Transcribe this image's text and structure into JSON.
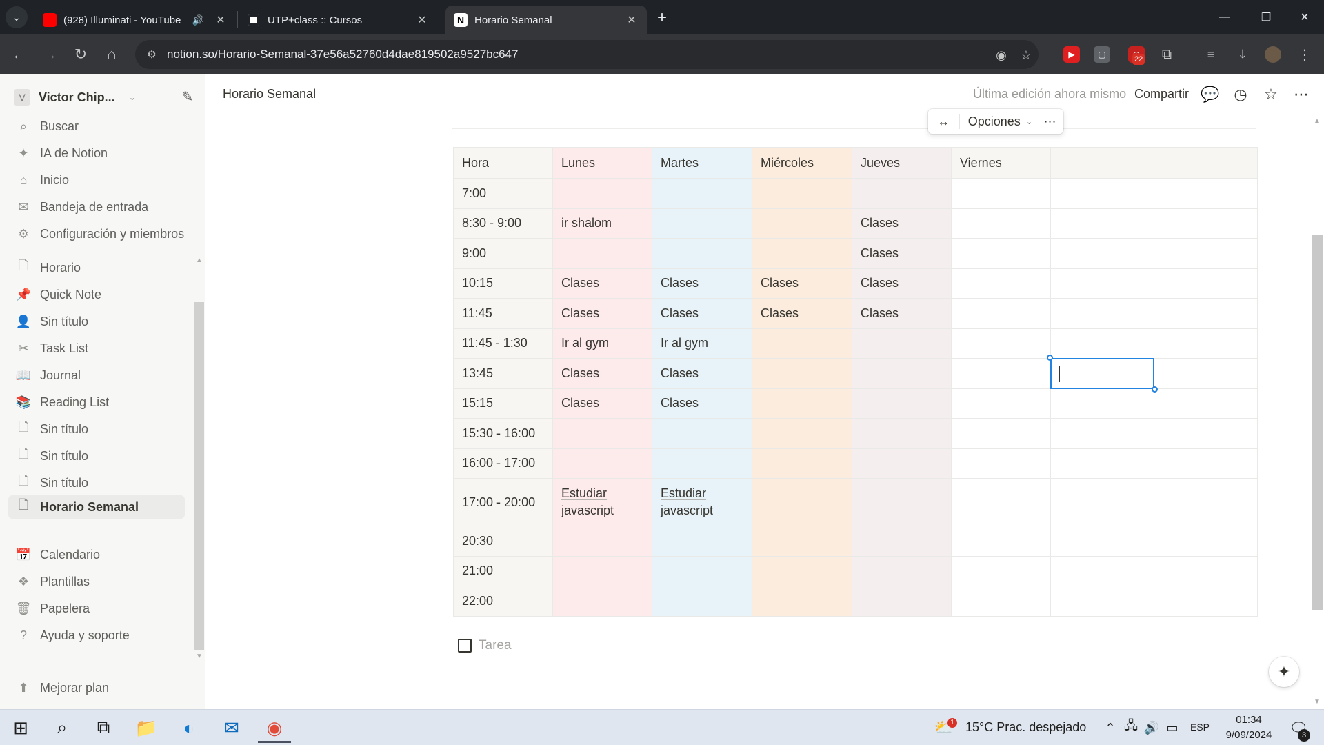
{
  "browser": {
    "tabs": [
      {
        "title": "(928) Illuminati - YouTube",
        "favicon": "youtube-icon",
        "color": "#ff0000"
      },
      {
        "title": "UTP+class :: Cursos",
        "favicon": "utp-icon",
        "color": "#ffffff"
      },
      {
        "title": "Horario Semanal",
        "favicon": "notion-icon",
        "color": "#ffffff"
      }
    ],
    "url": "notion.so/Horario-Semanal-37e56a52760d4dae819502a9527bc647",
    "extension_badge": "22"
  },
  "sidebar": {
    "workspace_initial": "V",
    "workspace_name": "Victor Chip...",
    "top_items": [
      {
        "label": "Buscar",
        "icon": "search-icon"
      },
      {
        "label": "IA de Notion",
        "icon": "sparkle-icon"
      },
      {
        "label": "Inicio",
        "icon": "home-icon"
      },
      {
        "label": "Bandeja de entrada",
        "icon": "inbox-icon"
      },
      {
        "label": "Configuración y miembros",
        "icon": "gear-icon"
      }
    ],
    "pages": [
      {
        "label": "Horario",
        "icon": "page-icon"
      },
      {
        "label": "Quick Note",
        "icon": "pin-icon"
      },
      {
        "label": "Sin título",
        "icon": "person-icon"
      },
      {
        "label": "Task List",
        "icon": "scissors-icon"
      },
      {
        "label": "Journal",
        "icon": "book-icon"
      },
      {
        "label": "Reading List",
        "icon": "books-icon"
      },
      {
        "label": "Sin título",
        "icon": "page-icon"
      },
      {
        "label": "Sin título",
        "icon": "page-icon"
      },
      {
        "label": "Sin título",
        "icon": "page-icon"
      },
      {
        "label": "Horario Semanal",
        "icon": "page-icon"
      }
    ],
    "bottom_items": [
      {
        "label": "Calendario",
        "icon": "calendar-icon"
      },
      {
        "label": "Plantillas",
        "icon": "templates-icon"
      },
      {
        "label": "Papelera",
        "icon": "trash-icon"
      },
      {
        "label": "Ayuda y soporte",
        "icon": "help-icon"
      }
    ],
    "upgrade_label": "Mejorar plan"
  },
  "topbar": {
    "breadcrumb": "Horario Semanal",
    "last_edited": "Última edición ahora mismo",
    "share_label": "Compartir"
  },
  "table_toolbar": {
    "options_label": "Opciones"
  },
  "schedule": {
    "headers": [
      "Hora",
      "Lunes",
      "Martes",
      "Miércoles",
      "Jueves",
      "Viernes",
      "",
      ""
    ],
    "rows": [
      [
        "7:00",
        "",
        "",
        "",
        "",
        "",
        "",
        ""
      ],
      [
        "8:30 - 9:00",
        "ir shalom",
        "",
        "",
        "Clases",
        "",
        "",
        ""
      ],
      [
        "9:00",
        "",
        "",
        "",
        "Clases",
        "",
        "",
        ""
      ],
      [
        "10:15",
        "Clases",
        "Clases",
        "Clases",
        "Clases",
        "",
        "",
        ""
      ],
      [
        "11:45",
        "Clases",
        "Clases",
        "Clases",
        "Clases",
        "",
        "",
        ""
      ],
      [
        "11:45 - 1:30",
        "Ir al gym",
        "Ir al gym",
        "",
        "",
        "",
        "",
        ""
      ],
      [
        "13:45",
        "Clases",
        "Clases",
        "",
        "",
        "",
        "",
        ""
      ],
      [
        "15:15",
        "Clases",
        "Clases",
        "",
        "",
        "",
        "",
        ""
      ],
      [
        "15:30 - 16:00",
        "",
        "",
        "",
        "",
        "",
        "",
        ""
      ],
      [
        "16:00 - 17:00",
        "",
        "",
        "",
        "",
        "",
        "",
        ""
      ],
      [
        "17:00 - 20:00",
        "Estudiar javascript",
        "Estudiar javascript",
        "",
        "",
        "",
        "",
        ""
      ],
      [
        "20:30",
        "",
        "",
        "",
        "",
        "",
        "",
        ""
      ],
      [
        "21:00",
        "",
        "",
        "",
        "",
        "",
        "",
        ""
      ],
      [
        "22:00",
        "",
        "",
        "",
        "",
        "",
        "",
        ""
      ]
    ],
    "column_colors": [
      "#f7f6f3",
      "#fdebec",
      "#e7f3f8",
      "#fbecdd",
      "#f4eeee",
      "#ffffff",
      "#ffffff",
      "#ffffff"
    ]
  },
  "todo": {
    "placeholder": "Tarea"
  },
  "taskbar": {
    "weather": "15°C  Prac. despejado",
    "weather_badge": "1",
    "language": "ESP",
    "time": "01:34",
    "date": "9/09/2024",
    "notification_count": "3"
  }
}
